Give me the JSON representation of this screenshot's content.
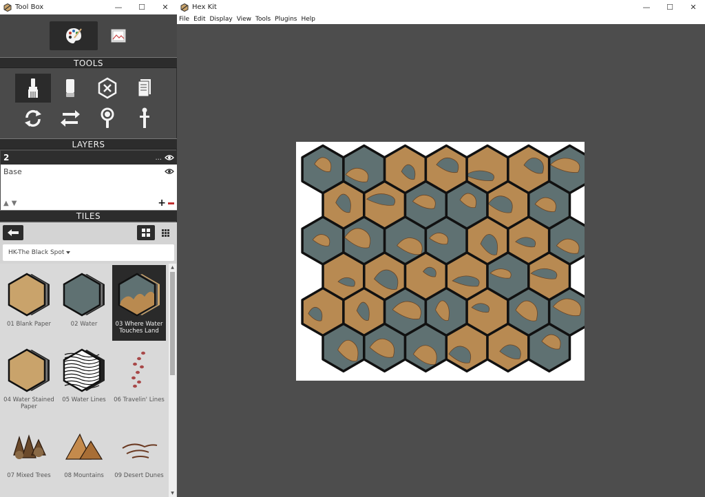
{
  "toolbox": {
    "title": "Tool Box",
    "modes": [
      {
        "name": "palette-icon",
        "active": true
      },
      {
        "name": "image-icon",
        "active": false
      }
    ],
    "sections": {
      "tools": "TOOLS",
      "layers": "LAYERS",
      "tiles": "TILES"
    },
    "tools": [
      {
        "name": "brush-tool-icon",
        "active": true
      },
      {
        "name": "eraser-tool-icon"
      },
      {
        "name": "clear-hex-tool-icon"
      },
      {
        "name": "notes-tool-icon"
      },
      {
        "name": "rotate-tool-icon"
      },
      {
        "name": "swap-tool-icon"
      },
      {
        "name": "magnify-tool-icon"
      },
      {
        "name": "pin-tool-icon"
      }
    ],
    "layers": {
      "active": {
        "name": "2",
        "dots": "...",
        "visibility_icon": "eye-icon"
      },
      "items": [
        {
          "name": "Base",
          "visibility_icon": "eye-icon"
        }
      ]
    },
    "tiles": {
      "tileset": "HK-The Black Spot",
      "items": [
        {
          "label": "01 Blank Paper",
          "kind": "paper"
        },
        {
          "label": "02 Water",
          "kind": "water"
        },
        {
          "label": "03 Where Water Touches Land",
          "kind": "shore",
          "selected": true
        },
        {
          "label": "04 Water Stained Paper",
          "kind": "paper"
        },
        {
          "label": "05 Water Lines",
          "kind": "lines"
        },
        {
          "label": "06 Travelin' Lines",
          "kind": "dots"
        },
        {
          "label": "07 Mixed Trees",
          "kind": "trees"
        },
        {
          "label": "08 Mountains",
          "kind": "mountains"
        },
        {
          "label": "09 Desert Dunes",
          "kind": "dunes"
        }
      ]
    }
  },
  "main": {
    "title": "Hex Kit",
    "menu": [
      "File",
      "Edit",
      "Display",
      "View",
      "Tools",
      "Plugins",
      "Help"
    ]
  },
  "colors": {
    "panel": "#4a4a4a",
    "header": "#2c2c2c",
    "water": "#5f7172",
    "land": "#b88a52",
    "hex_border": "#111111"
  }
}
